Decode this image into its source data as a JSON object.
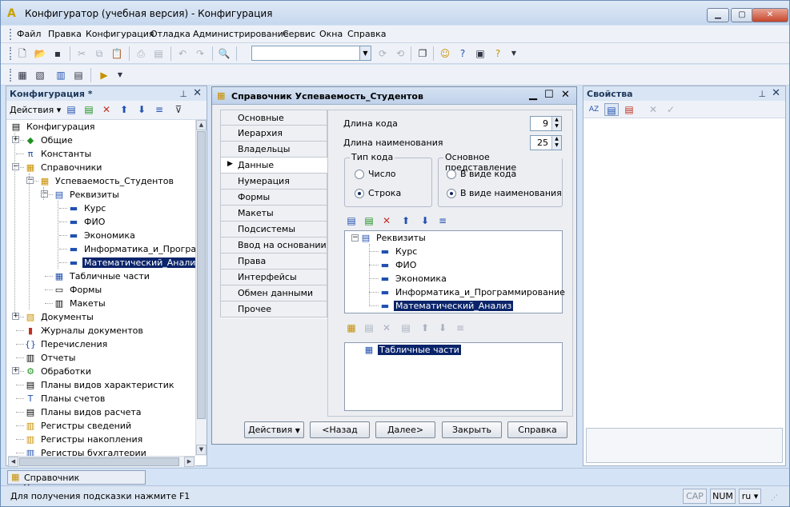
{
  "window": {
    "title": "Конфигуратор (учебная версия) - Конфигурация"
  },
  "menu": [
    "Файл",
    "Правка",
    "Конфигурация",
    "Отладка",
    "Администрирование",
    "Сервис",
    "Окна",
    "Справка"
  ],
  "toolbar": {
    "search_value": ""
  },
  "config_panel": {
    "title": "Конфигурация *",
    "actions_label": "Действия",
    "tree": [
      {
        "label": "Конфигурация",
        "icon": "config-icon"
      },
      {
        "label": "Общие",
        "icon": "common-icon"
      },
      {
        "label": "Константы",
        "icon": "constants-icon"
      },
      {
        "label": "Справочники",
        "icon": "catalogs-icon"
      },
      {
        "label": "Успеваемость_Студентов",
        "icon": "catalog-icon"
      },
      {
        "label": "Реквизиты",
        "icon": "attributes-icon"
      },
      {
        "label": "Курс",
        "icon": "attribute-icon"
      },
      {
        "label": "ФИО",
        "icon": "attribute-icon"
      },
      {
        "label": "Экономика",
        "icon": "attribute-icon"
      },
      {
        "label": "Информатика_и_Програм",
        "icon": "attribute-icon"
      },
      {
        "label": "Математический_Анализ",
        "icon": "attribute-icon"
      },
      {
        "label": "Табличные части",
        "icon": "tabular-icon"
      },
      {
        "label": "Формы",
        "icon": "forms-icon"
      },
      {
        "label": "Макеты",
        "icon": "templates-icon"
      },
      {
        "label": "Документы",
        "icon": "documents-icon"
      },
      {
        "label": "Журналы документов",
        "icon": "journals-icon"
      },
      {
        "label": "Перечисления",
        "icon": "enums-icon"
      },
      {
        "label": "Отчеты",
        "icon": "reports-icon"
      },
      {
        "label": "Обработки",
        "icon": "processing-icon"
      },
      {
        "label": "Планы видов характеристик",
        "icon": "chart-chars-icon"
      },
      {
        "label": "Планы счетов",
        "icon": "chart-accounts-icon"
      },
      {
        "label": "Планы видов расчета",
        "icon": "chart-calc-icon"
      },
      {
        "label": "Регистры сведений",
        "icon": "info-reg-icon"
      },
      {
        "label": "Регистры накопления",
        "icon": "accum-reg-icon"
      },
      {
        "label": "Регистры бухгалтерии",
        "icon": "acc-reg-icon"
      }
    ]
  },
  "dialog": {
    "title": "Справочник Успеваемость_Студентов",
    "nav": [
      "Основные",
      "Иерархия",
      "Владельцы",
      "Данные",
      "Нумерация",
      "Формы",
      "Макеты",
      "Подсистемы",
      "Ввод на основании",
      "Права",
      "Интерфейсы",
      "Обмен данными",
      "Прочее"
    ],
    "active_nav": "Данные",
    "code_length_label": "Длина кода",
    "code_length": "9",
    "name_length_label": "Длина наименования",
    "name_length": "25",
    "code_type": {
      "title": "Тип кода",
      "options": [
        "Число",
        "Строка"
      ],
      "selected": "Строка"
    },
    "main_repr": {
      "title": "Основное представление",
      "options": [
        "В виде кода",
        "В виде наименования"
      ],
      "selected": "В виде наименования"
    },
    "attr_tree": {
      "root": "Реквизиты",
      "items": [
        "Курс",
        "ФИО",
        "Экономика",
        "Информатика_и_Программирование",
        "Математический_Анализ"
      ],
      "selected": "Математический_Анализ"
    },
    "tabular_tree": {
      "root": "Табличные части"
    },
    "buttons": {
      "actions": "Действия",
      "back": "<Назад",
      "next": "Далее>",
      "close": "Закрыть",
      "help": "Справка"
    }
  },
  "props_panel": {
    "title": "Свойства"
  },
  "taskbar": {
    "item": "Справочник Успеваемость..."
  },
  "status": {
    "message": "Для получения подсказки нажмите F1",
    "cap": "CAP",
    "num": "NUM",
    "lang": "ru"
  }
}
